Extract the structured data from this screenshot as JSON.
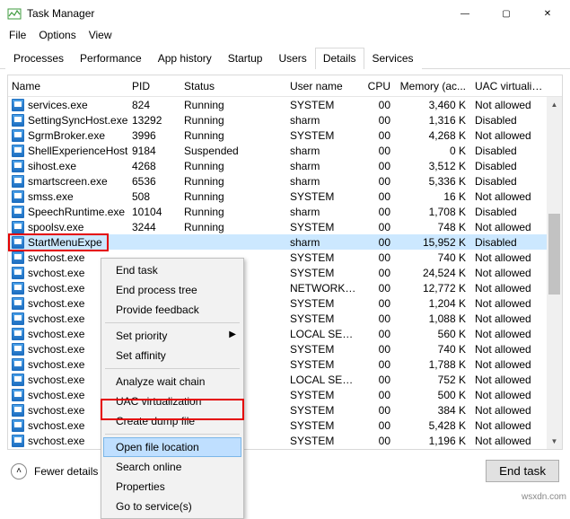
{
  "window": {
    "title": "Task Manager",
    "min": "—",
    "max": "▢",
    "close": "✕"
  },
  "menubar": [
    "File",
    "Options",
    "View"
  ],
  "tabs": [
    "Processes",
    "Performance",
    "App history",
    "Startup",
    "Users",
    "Details",
    "Services"
  ],
  "active_tab": "Details",
  "columns": [
    "Name",
    "PID",
    "Status",
    "User name",
    "CPU",
    "Memory (ac...",
    "UAC virtualizati..."
  ],
  "rows": [
    {
      "name": "services.exe",
      "pid": "824",
      "status": "Running",
      "user": "SYSTEM",
      "cpu": "00",
      "mem": "3,460 K",
      "uac": "Not allowed"
    },
    {
      "name": "SettingSyncHost.exe",
      "pid": "13292",
      "status": "Running",
      "user": "sharm",
      "cpu": "00",
      "mem": "1,316 K",
      "uac": "Disabled"
    },
    {
      "name": "SgrmBroker.exe",
      "pid": "3996",
      "status": "Running",
      "user": "SYSTEM",
      "cpu": "00",
      "mem": "4,268 K",
      "uac": "Not allowed"
    },
    {
      "name": "ShellExperienceHost....",
      "pid": "9184",
      "status": "Suspended",
      "user": "sharm",
      "cpu": "00",
      "mem": "0 K",
      "uac": "Disabled"
    },
    {
      "name": "sihost.exe",
      "pid": "4268",
      "status": "Running",
      "user": "sharm",
      "cpu": "00",
      "mem": "3,512 K",
      "uac": "Disabled"
    },
    {
      "name": "smartscreen.exe",
      "pid": "6536",
      "status": "Running",
      "user": "sharm",
      "cpu": "00",
      "mem": "5,336 K",
      "uac": "Disabled"
    },
    {
      "name": "smss.exe",
      "pid": "508",
      "status": "Running",
      "user": "SYSTEM",
      "cpu": "00",
      "mem": "16 K",
      "uac": "Not allowed"
    },
    {
      "name": "SpeechRuntime.exe",
      "pid": "10104",
      "status": "Running",
      "user": "sharm",
      "cpu": "00",
      "mem": "1,708 K",
      "uac": "Disabled"
    },
    {
      "name": "spoolsv.exe",
      "pid": "3244",
      "status": "Running",
      "user": "SYSTEM",
      "cpu": "00",
      "mem": "748 K",
      "uac": "Not allowed"
    },
    {
      "name": "StartMenuExpe",
      "pid": "",
      "status": "",
      "user": "sharm",
      "cpu": "00",
      "mem": "15,952 K",
      "uac": "Disabled",
      "selected": true
    },
    {
      "name": "svchost.exe",
      "pid": "",
      "status": "",
      "user": "SYSTEM",
      "cpu": "00",
      "mem": "740 K",
      "uac": "Not allowed"
    },
    {
      "name": "svchost.exe",
      "pid": "",
      "status": "",
      "user": "SYSTEM",
      "cpu": "00",
      "mem": "24,524 K",
      "uac": "Not allowed"
    },
    {
      "name": "svchost.exe",
      "pid": "",
      "status": "",
      "user": "NETWORK ...",
      "cpu": "00",
      "mem": "12,772 K",
      "uac": "Not allowed"
    },
    {
      "name": "svchost.exe",
      "pid": "",
      "status": "",
      "user": "SYSTEM",
      "cpu": "00",
      "mem": "1,204 K",
      "uac": "Not allowed"
    },
    {
      "name": "svchost.exe",
      "pid": "",
      "status": "",
      "user": "SYSTEM",
      "cpu": "00",
      "mem": "1,088 K",
      "uac": "Not allowed"
    },
    {
      "name": "svchost.exe",
      "pid": "",
      "status": "",
      "user": "LOCAL SER...",
      "cpu": "00",
      "mem": "560 K",
      "uac": "Not allowed"
    },
    {
      "name": "svchost.exe",
      "pid": "",
      "status": "",
      "user": "SYSTEM",
      "cpu": "00",
      "mem": "740 K",
      "uac": "Not allowed"
    },
    {
      "name": "svchost.exe",
      "pid": "",
      "status": "",
      "user": "SYSTEM",
      "cpu": "00",
      "mem": "1,788 K",
      "uac": "Not allowed"
    },
    {
      "name": "svchost.exe",
      "pid": "",
      "status": "",
      "user": "LOCAL SER...",
      "cpu": "00",
      "mem": "752 K",
      "uac": "Not allowed"
    },
    {
      "name": "svchost.exe",
      "pid": "",
      "status": "",
      "user": "SYSTEM",
      "cpu": "00",
      "mem": "500 K",
      "uac": "Not allowed"
    },
    {
      "name": "svchost.exe",
      "pid": "",
      "status": "",
      "user": "SYSTEM",
      "cpu": "00",
      "mem": "384 K",
      "uac": "Not allowed"
    },
    {
      "name": "svchost.exe",
      "pid": "",
      "status": "",
      "user": "SYSTEM",
      "cpu": "00",
      "mem": "5,428 K",
      "uac": "Not allowed"
    },
    {
      "name": "svchost.exe",
      "pid": "",
      "status": "",
      "user": "SYSTEM",
      "cpu": "00",
      "mem": "1,196 K",
      "uac": "Not allowed"
    }
  ],
  "context_menu": [
    {
      "label": "End task"
    },
    {
      "label": "End process tree"
    },
    {
      "label": "Provide feedback"
    },
    {
      "sep": true
    },
    {
      "label": "Set priority",
      "submenu": true
    },
    {
      "label": "Set affinity"
    },
    {
      "sep": true
    },
    {
      "label": "Analyze wait chain"
    },
    {
      "label": "UAC virtualization"
    },
    {
      "label": "Create dump file"
    },
    {
      "sep": true
    },
    {
      "label": "Open file location",
      "hover": true
    },
    {
      "label": "Search online"
    },
    {
      "label": "Properties"
    },
    {
      "label": "Go to service(s)"
    }
  ],
  "footer": {
    "fewer": "Fewer details",
    "endtask": "End task"
  },
  "watermark": "wsxdn.com"
}
